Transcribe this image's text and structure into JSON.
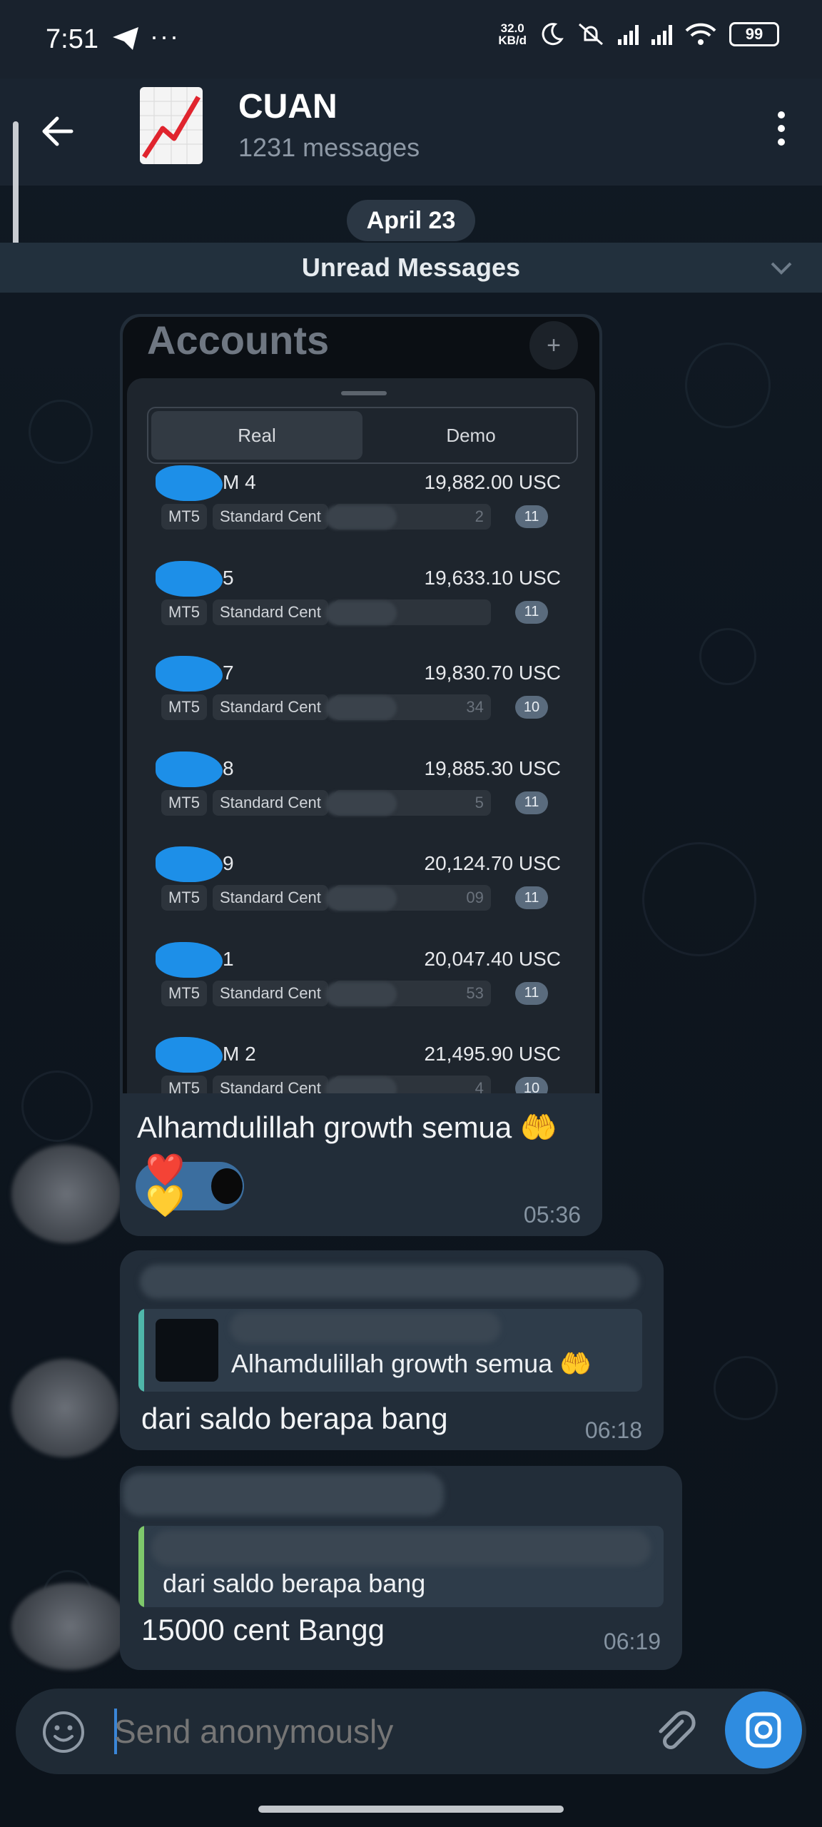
{
  "status_bar": {
    "time": "7:51",
    "more": "···",
    "speed_value": "32.0",
    "speed_unit": "KB/d",
    "battery": "99",
    "wifi_sub": "6"
  },
  "header": {
    "title": "CUAN",
    "subtitle": "1231 messages"
  },
  "date_chip": "April 23",
  "unread_label": "Unread Messages",
  "screenshot": {
    "title": "Accounts",
    "plus": "+",
    "tabs": [
      "Real",
      "Demo"
    ],
    "accounts": [
      {
        "name": "M 4",
        "balance": "19,882.00 USC",
        "platform": "MT5",
        "type": "Standard Cent",
        "id": "#",
        "id_tail": "2",
        "leverage": "11"
      },
      {
        "name": "5",
        "balance": "19,633.10 USC",
        "platform": "MT5",
        "type": "Standard Cent",
        "id": "#",
        "id_tail": "",
        "leverage": "11"
      },
      {
        "name": "7",
        "balance": "19,830.70 USC",
        "platform": "MT5",
        "type": "Standard Cent",
        "id": "",
        "id_tail": "34",
        "leverage": "10"
      },
      {
        "name": "8",
        "balance": "19,885.30 USC",
        "platform": "MT5",
        "type": "Standard Cent",
        "id": "#",
        "id_tail": "5",
        "leverage": "11"
      },
      {
        "name": "9",
        "balance": "20,124.70 USC",
        "platform": "MT5",
        "type": "Standard Cent",
        "id": "",
        "id_tail": "09",
        "leverage": "11"
      },
      {
        "name": "1",
        "balance": "20,047.40 USC",
        "platform": "MT5",
        "type": "Standard Cent",
        "id": "#",
        "id_tail": "53",
        "leverage": "11"
      },
      {
        "name": "M 2",
        "balance": "21,495.90 USC",
        "platform": "MT5",
        "type": "Standard Cent",
        "id": "# 25",
        "id_tail": "4",
        "leverage": "10"
      }
    ]
  },
  "messages": [
    {
      "text": "Alhamdulillah growth semua 🤲",
      "time": "05:36",
      "reaction": "❤️💛"
    },
    {
      "quote": "Alhamdulillah growth semua 🤲",
      "text": "dari saldo berapa bang",
      "time": "06:18"
    },
    {
      "quote": "dari saldo berapa bang",
      "text": "15000 cent Bangg",
      "time": "06:19"
    }
  ],
  "input": {
    "placeholder": "Send anonymously"
  },
  "colors": {
    "accent": "#2f8ce0",
    "bubble": "#222d39",
    "reaction_bg": "#3b6e9f",
    "quote_bar_1": "#4fb6a9",
    "quote_bar_2": "#7ec86b"
  },
  "icons": {
    "back": "arrow-left-icon",
    "menu": "more-vertical-icon",
    "emoji": "smile-icon",
    "attach": "paperclip-icon",
    "camera": "camera-icon",
    "chevron": "chevron-down-icon"
  }
}
